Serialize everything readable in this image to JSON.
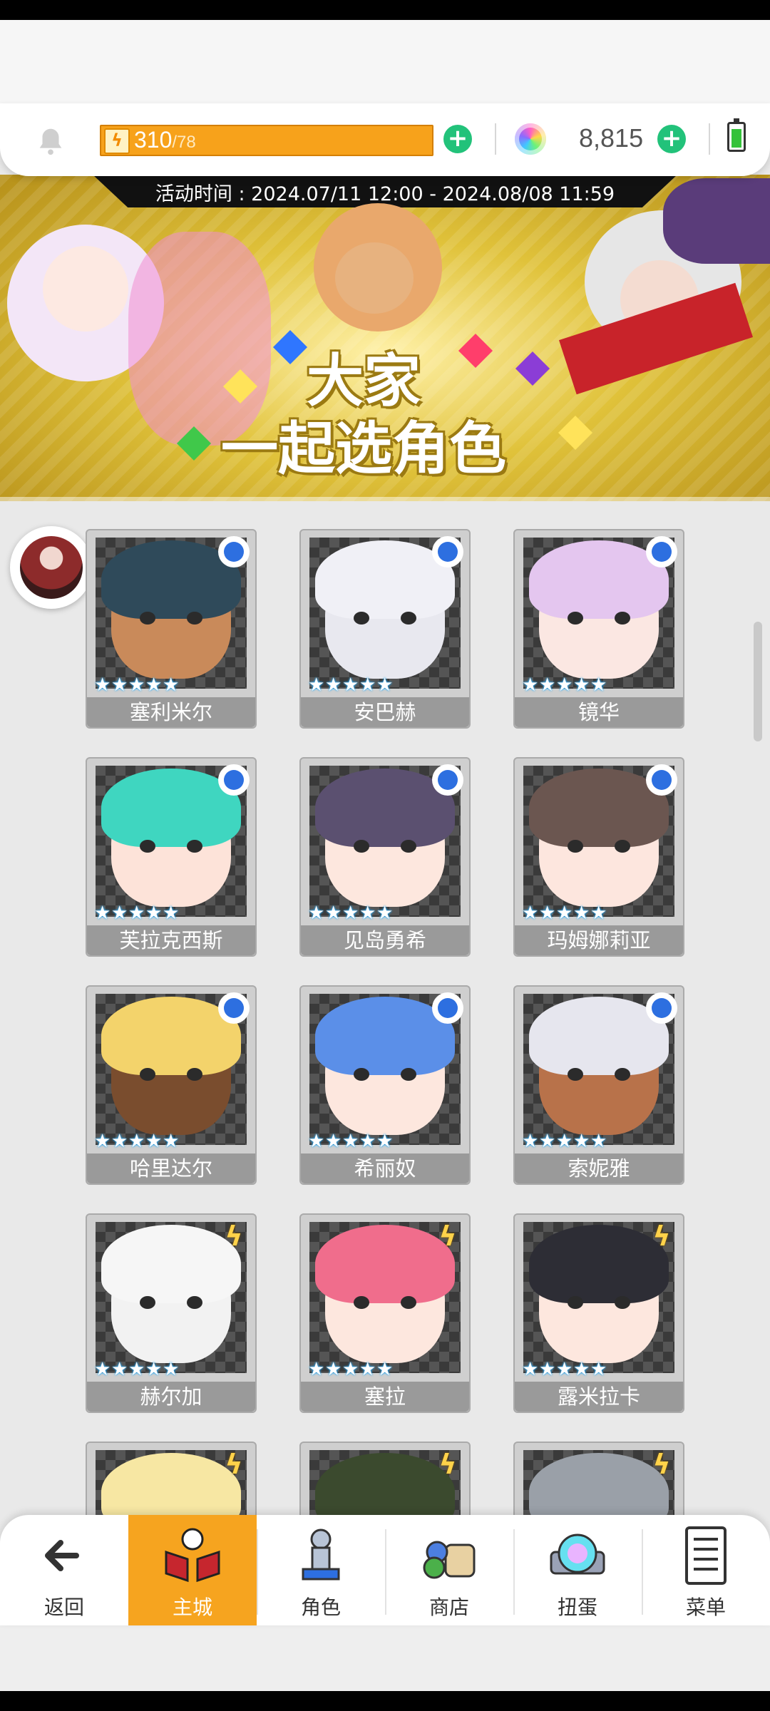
{
  "hud": {
    "energy_current": "310",
    "energy_max": "/78",
    "gem_count": "8,815"
  },
  "banner": {
    "event_time": "活动时间 : 2024.07/11 12:00 - 2024.08/08 11:59",
    "title_line1": "大家",
    "title_line2": "一起选角色"
  },
  "characters": [
    {
      "name": "塞利米尔",
      "status": "selected-circle",
      "hair": "#2f4a5a",
      "skin": "#c98a5a"
    },
    {
      "name": "安巴赫",
      "status": "selected-circle",
      "hair": "#f0f0f6",
      "skin": "#e8e8ef"
    },
    {
      "name": "镜华",
      "status": "selected-circle",
      "hair": "#e4c6ef",
      "skin": "#fbe7e2"
    },
    {
      "name": "芙拉克西斯",
      "status": "selected-circle",
      "hair": "#3fd6c0",
      "skin": "#fde3d9"
    },
    {
      "name": "见岛勇希",
      "status": "selected-circle",
      "hair": "#5b5070",
      "skin": "#fde7de"
    },
    {
      "name": "玛姆娜莉亚",
      "status": "selected-circle",
      "hair": "#6b5650",
      "skin": "#fde6de"
    },
    {
      "name": "哈里达尔",
      "status": "selected-circle",
      "hair": "#f3d36b",
      "skin": "#7a4d2e"
    },
    {
      "name": "希丽奴",
      "status": "selected-circle",
      "hair": "#5b8fe8",
      "skin": "#fde7de"
    },
    {
      "name": "索妮雅",
      "status": "selected-circle",
      "hair": "#e6e6ee",
      "skin": "#b8724a"
    },
    {
      "name": "赫尔加",
      "status": "bolt",
      "hair": "#f6f6f6",
      "skin": "#f2f2f2"
    },
    {
      "name": "塞拉",
      "status": "bolt",
      "hair": "#f06d8c",
      "skin": "#fde7de"
    },
    {
      "name": "露米拉卡",
      "status": "bolt",
      "hair": "#2d2d35",
      "skin": "#fde7de"
    },
    {
      "name": "",
      "status": "bolt",
      "hair": "#f7e7a3",
      "skin": "#fde7de"
    },
    {
      "name": "",
      "status": "bolt",
      "hair": "#3b4a2e",
      "skin": "#6e4a30"
    },
    {
      "name": "",
      "status": "bolt",
      "hair": "#9aa0a8",
      "skin": "#c7ccd2"
    }
  ],
  "nav": {
    "back": "返回",
    "main_city": "主城",
    "character": "角色",
    "shop": "商店",
    "gacha": "扭蛋",
    "menu": "菜单"
  },
  "icons": [
    "bell-icon",
    "lightning-icon",
    "plus-icon",
    "gem-icon",
    "battery-icon",
    "back-arrow-icon",
    "castle-icon",
    "statue-icon",
    "shop-bag-icon",
    "gacha-orb-icon",
    "menu-list-icon",
    "selected-circle-icon",
    "bolt-icon",
    "star-icon"
  ],
  "colors": {
    "energy_bar": "#f7a21b",
    "plus_button": "#22c27a",
    "nav_active": "#f6a41f",
    "selection_circle": "#2d6fe0",
    "bolt_badge": "#ffd24a"
  }
}
